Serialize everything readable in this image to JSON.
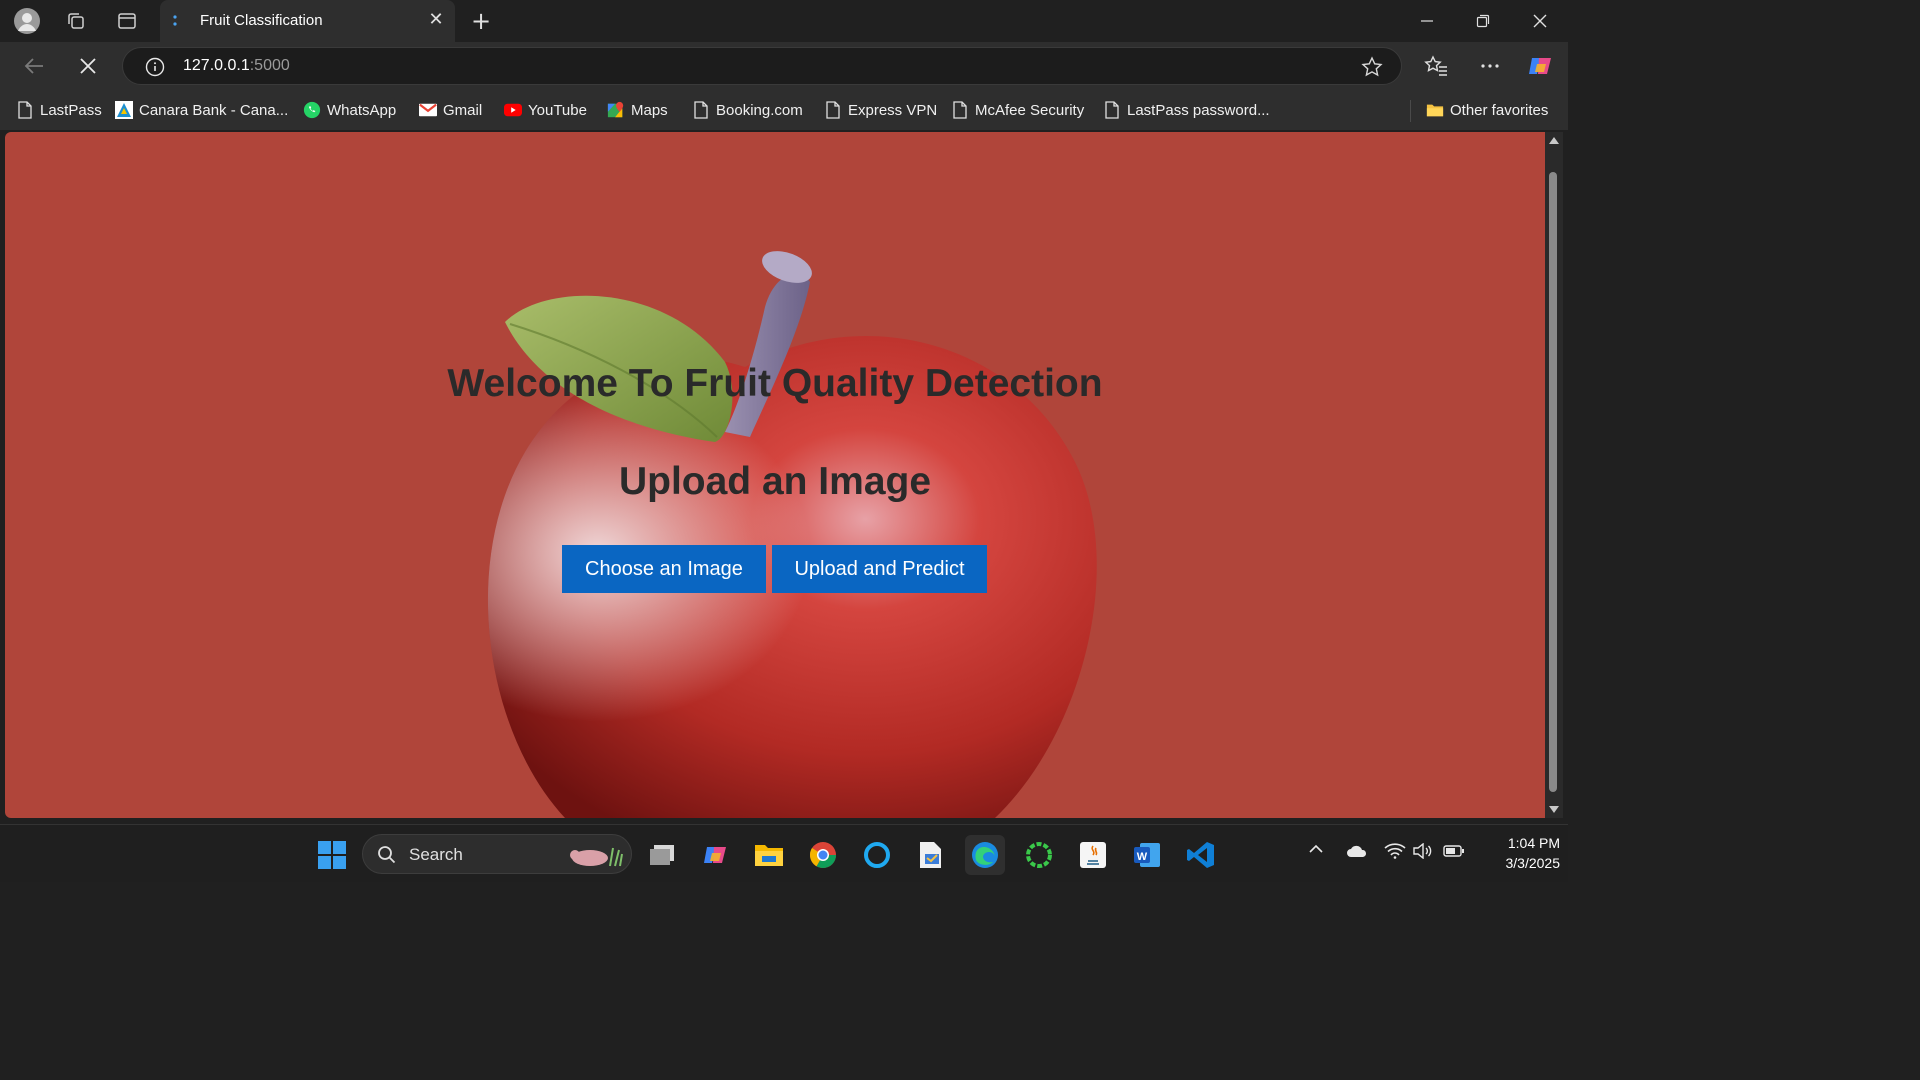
{
  "browser": {
    "tab_title": "Fruit Classification",
    "url_host": "127.0.0.1",
    "url_port": ":5000",
    "other_favorites": "Other favorites",
    "bookmarks": [
      {
        "label": "LastPass",
        "icon": "page-icon"
      },
      {
        "label": "Canara Bank - Cana...",
        "icon": "canara-icon"
      },
      {
        "label": "WhatsApp",
        "icon": "whatsapp-icon"
      },
      {
        "label": "Gmail",
        "icon": "gmail-icon"
      },
      {
        "label": "YouTube",
        "icon": "youtube-icon"
      },
      {
        "label": "Maps",
        "icon": "maps-icon"
      },
      {
        "label": "Booking.com",
        "icon": "page-icon"
      },
      {
        "label": "Express VPN",
        "icon": "page-icon"
      },
      {
        "label": "McAfee Security",
        "icon": "page-icon"
      },
      {
        "label": "LastPass password...",
        "icon": "page-icon"
      }
    ]
  },
  "page": {
    "welcome_heading": "Welcome To Fruit Quality Detection",
    "upload_heading": "Upload an Image",
    "choose_button": "Choose an Image",
    "predict_button": "Upload and Predict",
    "background_color": "#b0453a",
    "button_color": "#0a66c2"
  },
  "taskbar": {
    "search_label": "Search",
    "time": "1:04 PM",
    "date": "3/3/2025"
  }
}
